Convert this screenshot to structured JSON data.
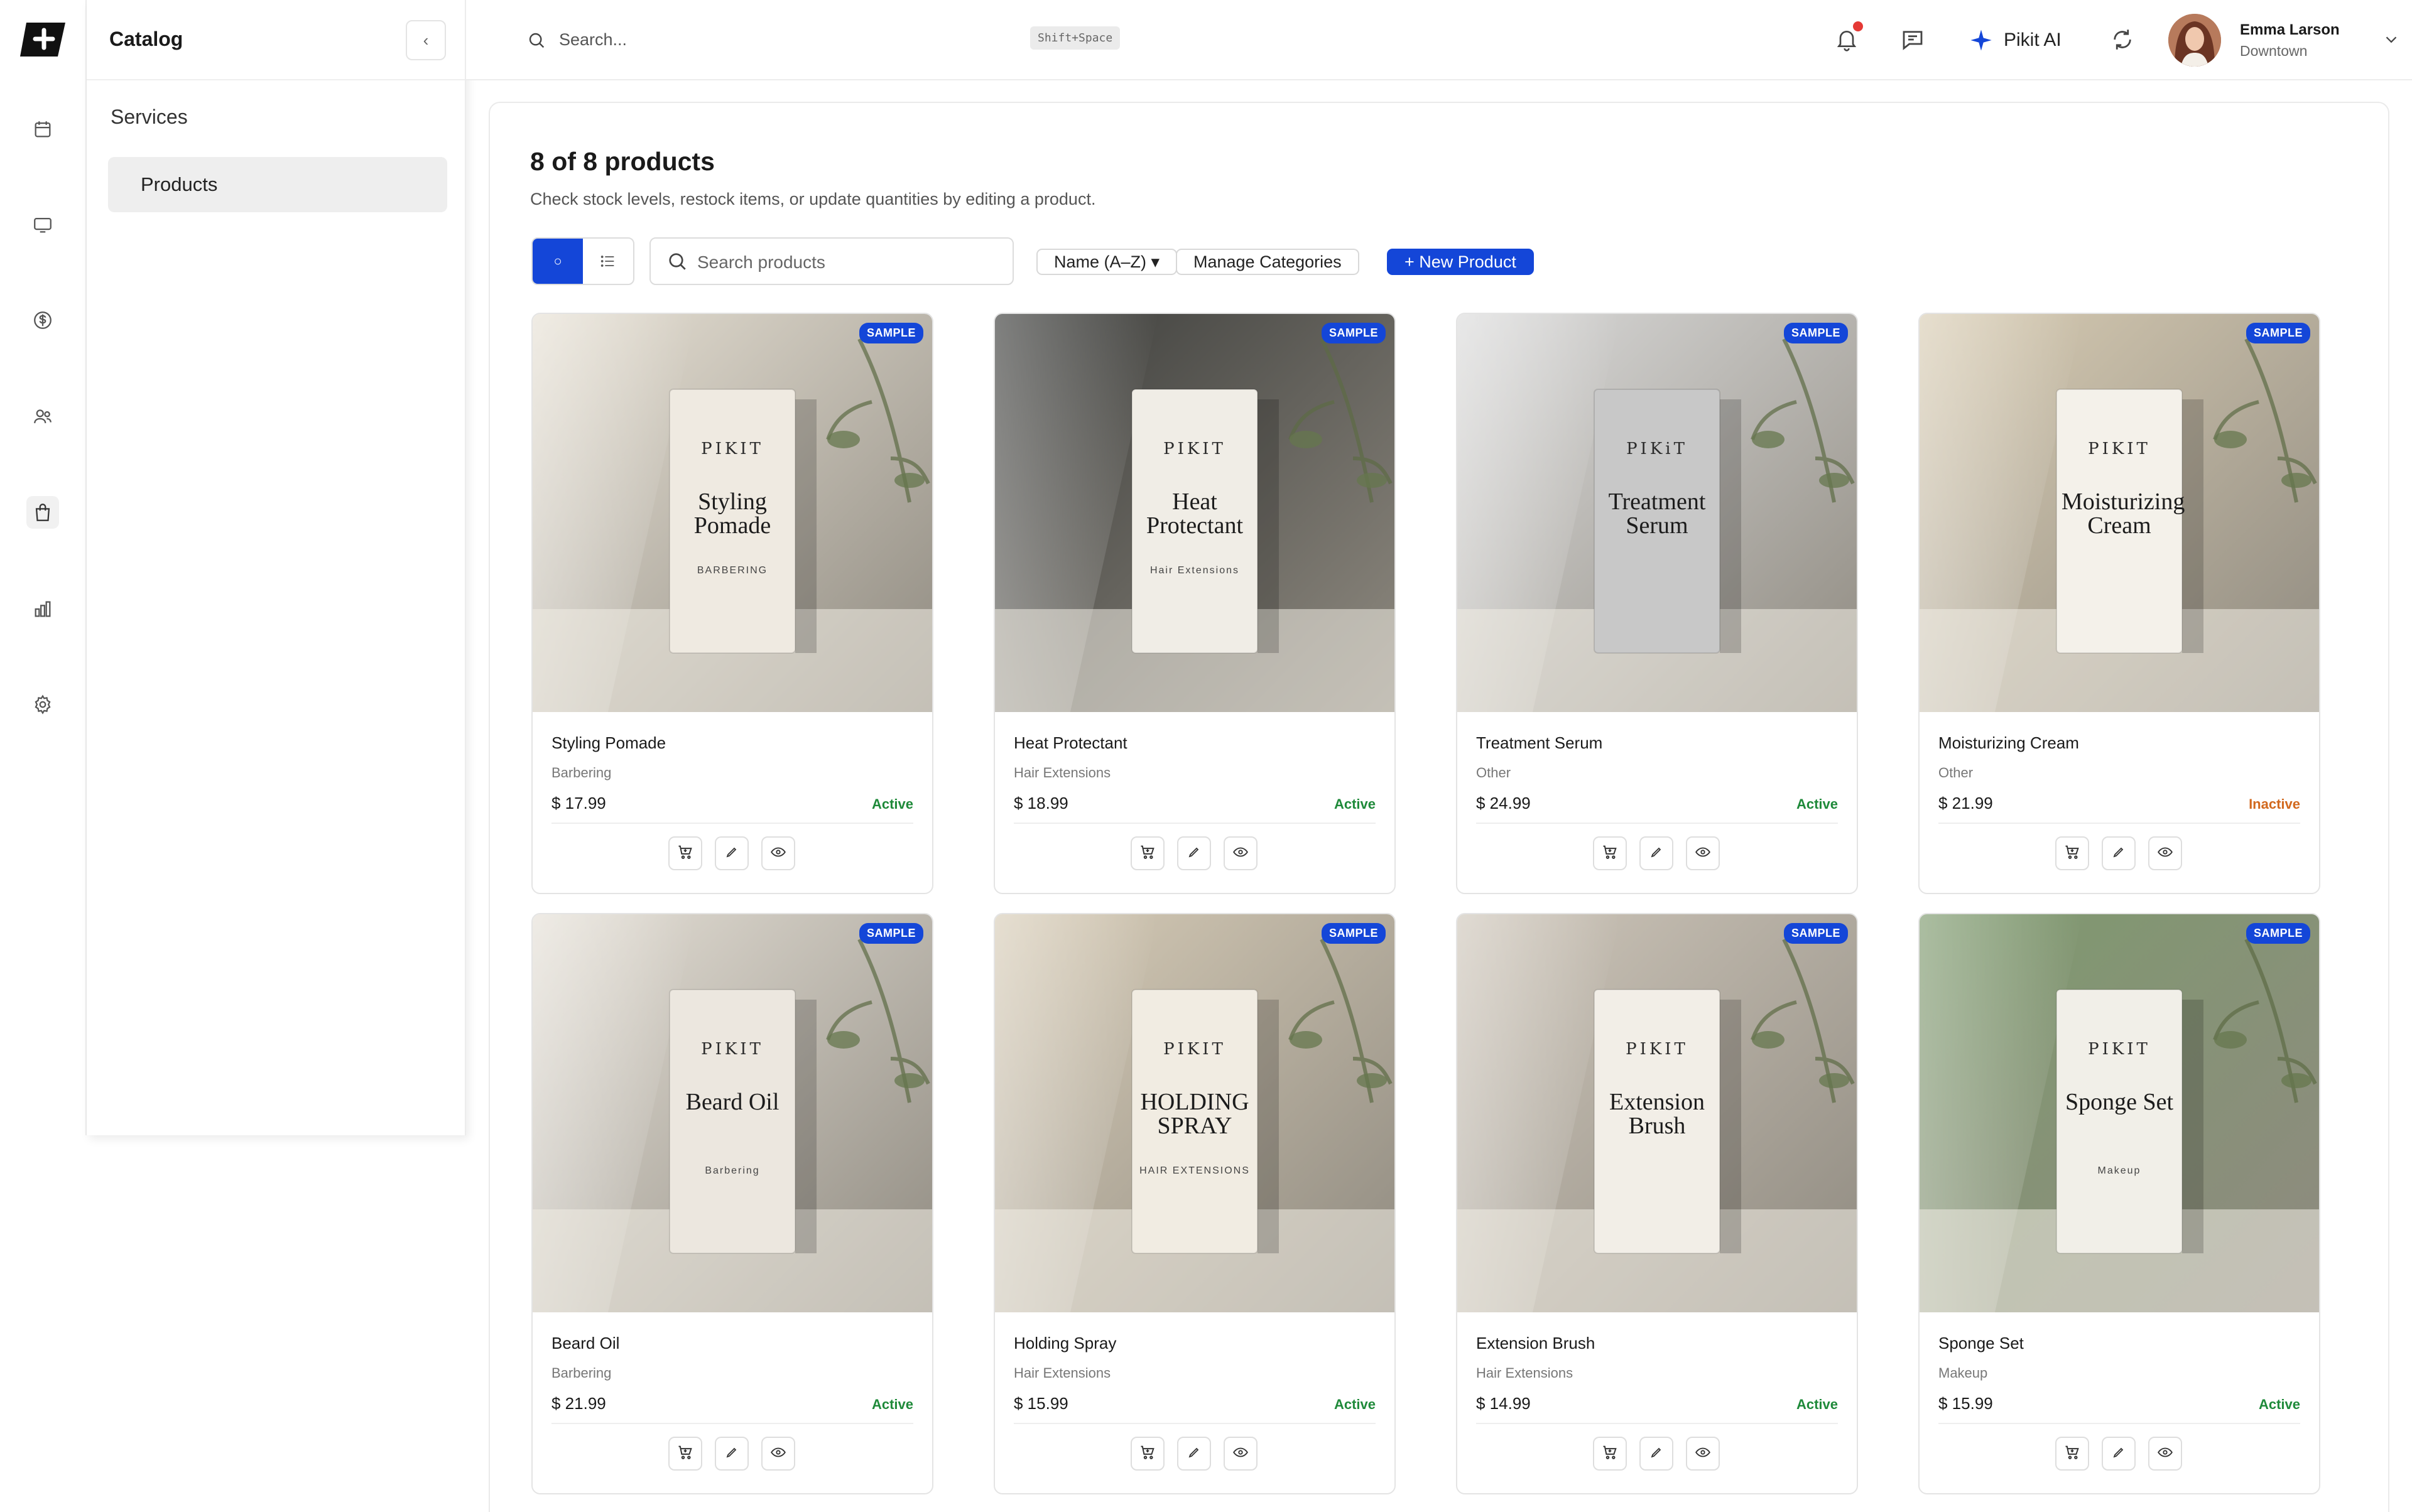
{
  "rail": {
    "items": [
      {
        "icon": "calendar-icon"
      },
      {
        "icon": "monitor-icon"
      },
      {
        "icon": "dollar-icon"
      },
      {
        "icon": "users-icon"
      },
      {
        "icon": "shopping-bag-icon",
        "active": true
      },
      {
        "icon": "bar-chart-icon"
      },
      {
        "icon": "gear-icon"
      }
    ]
  },
  "sidebar": {
    "title": "Catalog",
    "collapse_label": "‹",
    "section_label": "Services",
    "items": [
      {
        "label": "Products",
        "active": true
      }
    ]
  },
  "topbar": {
    "search_placeholder": "Search...",
    "shortcut": "Shift+Space",
    "ai_label": "Pikit AI",
    "user": {
      "name": "Emma Larson",
      "location": "Downtown"
    }
  },
  "main": {
    "heading": "8 of 8 products",
    "subheading": "Check stock levels, restock items, or update quantities by editing a product.",
    "view_toggle": {
      "grid_label": "○"
    },
    "search_placeholder": "Search products",
    "sort_label": "Name (A–Z) ▾",
    "manage_label": "Manage Categories",
    "new_label": "+ New Product"
  },
  "products": [
    {
      "name": "Styling Pomade",
      "category": "Barbering",
      "price": "$ 17.99",
      "status": "Active",
      "badge": "SAMPLE",
      "pkg_brand": "PIKIT",
      "pkg_title": "Styling Pomade",
      "pkg_sub": "BARBERING",
      "colors": {
        "bg": "#e8e2d6",
        "pkg": "#efeae1"
      }
    },
    {
      "name": "Heat Protectant",
      "category": "Hair Extensions",
      "price": "$ 18.99",
      "status": "Active",
      "badge": "SAMPLE",
      "pkg_brand": "PIKIT",
      "pkg_title": "Heat Protectant",
      "pkg_sub": "Hair Extensions",
      "colors": {
        "bg": "#3b3c3a",
        "pkg": "#f0ede6"
      }
    },
    {
      "name": "Treatment Serum",
      "category": "Other",
      "price": "$ 24.99",
      "status": "Active",
      "badge": "SAMPLE",
      "pkg_brand": "PIKiT",
      "pkg_title": "Treatment Serum",
      "pkg_sub": "",
      "colors": {
        "bg": "#dcdcdc",
        "pkg": "#c8c8c8"
      }
    },
    {
      "name": "Moisturizing Cream",
      "category": "Other",
      "price": "$ 21.99",
      "status": "Inactive",
      "badge": "SAMPLE",
      "pkg_brand": "PIKIT",
      "pkg_title": "Moisturizing Cream",
      "pkg_sub": "",
      "colors": {
        "bg": "#d9cdb4",
        "pkg": "#f4f1ea"
      }
    },
    {
      "name": "Beard Oil",
      "category": "Barbering",
      "price": "$ 21.99",
      "status": "Active",
      "badge": "SAMPLE",
      "pkg_brand": "PIKIT",
      "pkg_title": "Beard Oil",
      "pkg_sub": "Barbering",
      "colors": {
        "bg": "#e6e1d8",
        "pkg": "#ece7df"
      }
    },
    {
      "name": "Holding Spray",
      "category": "Hair Extensions",
      "price": "$ 15.99",
      "status": "Active",
      "badge": "SAMPLE",
      "pkg_brand": "PIKIT",
      "pkg_title": "HOLDING SPRAY",
      "pkg_sub": "HAIR EXTENSIONS",
      "colors": {
        "bg": "#d8cdb8",
        "pkg": "#f1ece2"
      }
    },
    {
      "name": "Extension Brush",
      "category": "Hair Extensions",
      "price": "$ 14.99",
      "status": "Active",
      "badge": "SAMPLE",
      "pkg_brand": "PIKIT",
      "pkg_title": "Extension Brush",
      "pkg_sub": "",
      "colors": {
        "bg": "#cfc7bb",
        "pkg": "#f2eee7"
      }
    },
    {
      "name": "Sponge Set",
      "category": "Makeup",
      "price": "$ 15.99",
      "status": "Active",
      "badge": "SAMPLE",
      "pkg_brand": "PIKIT",
      "pkg_title": "Sponge Set",
      "pkg_sub": "Makeup",
      "colors": {
        "bg": "#7e9a6e",
        "pkg": "#f1efe8"
      }
    }
  ]
}
